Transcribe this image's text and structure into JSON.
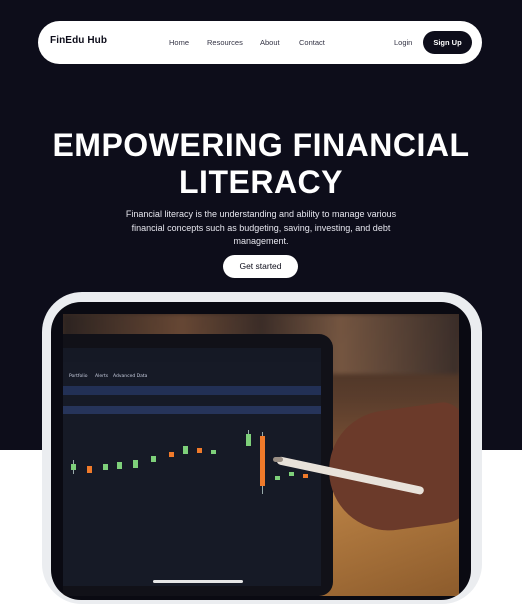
{
  "nav": {
    "brand": "FinEdu Hub",
    "links": [
      "Home",
      "Resources",
      "About",
      "Contact"
    ],
    "login": "Login",
    "signup": "Sign Up"
  },
  "hero": {
    "title_line1": "EMPOWERING FINANCIAL",
    "title_line2": "LITERACY",
    "subtitle": "Financial literacy is the understanding and ability to manage various financial concepts such as budgeting, saving, investing, and debt management.",
    "cta": "Get started"
  },
  "screen": {
    "tabs": [
      "Portfolio",
      "Alerts",
      "Advanced Data"
    ]
  },
  "colors": {
    "background": "#0d0d1a",
    "nav_bg": "#ffffff",
    "frame": "#ebedf0",
    "candle_up": "#7ed07a",
    "candle_down": "#f07a2a"
  }
}
